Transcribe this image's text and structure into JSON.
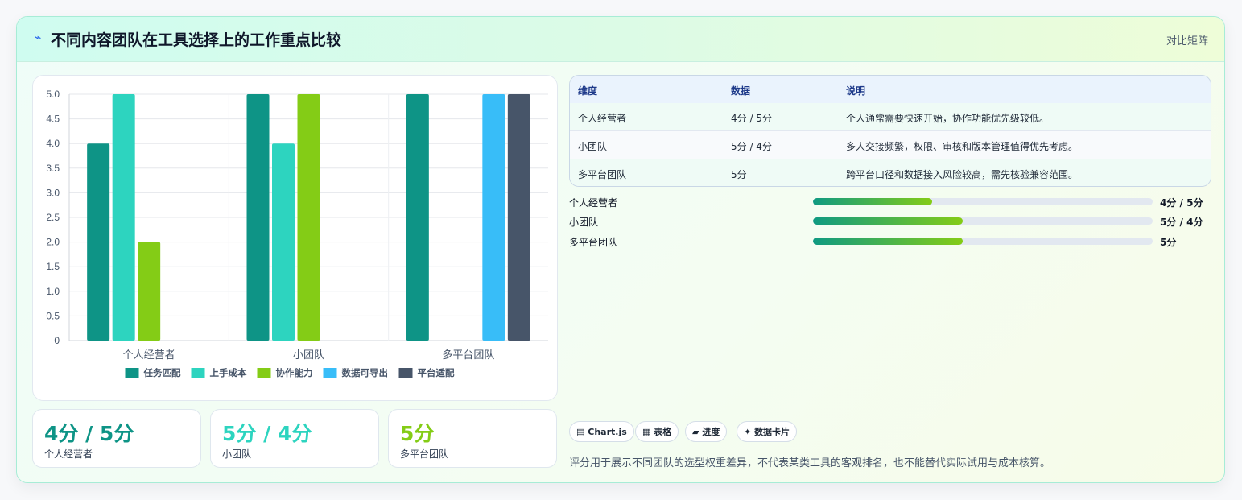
{
  "header": {
    "icon": "lightning-icon",
    "title": "不同内容团队在工具选择上的工作重点比较",
    "tag": "对比矩阵"
  },
  "colors": {
    "task_match": "#0e9486",
    "ease_cost": "#2dd4bf",
    "collaboration": "#84cc16",
    "data_export": "#38bdf8",
    "platform_fit": "#475569"
  },
  "chart_data": {
    "type": "bar",
    "categories": [
      "个人经营者",
      "小团队",
      "多平台团队"
    ],
    "series": [
      {
        "name": "任务匹配",
        "color": "#0e9486",
        "values": [
          4,
          5,
          5
        ]
      },
      {
        "name": "上手成本",
        "color": "#2dd4bf",
        "values": [
          5,
          4,
          null
        ]
      },
      {
        "name": "协作能力",
        "color": "#84cc16",
        "values": [
          2,
          5,
          null
        ]
      },
      {
        "name": "数据可导出",
        "color": "#38bdf8",
        "values": [
          null,
          null,
          5
        ]
      },
      {
        "name": "平台适配",
        "color": "#475569",
        "values": [
          null,
          null,
          5
        ]
      }
    ],
    "ylim": [
      0,
      5
    ],
    "yticks": [
      "0",
      "0.5",
      "1.0",
      "1.5",
      "2.0",
      "2.5",
      "3.0",
      "3.5",
      "4.0",
      "4.5",
      "5.0"
    ],
    "grid": true,
    "legend_position": "bottom"
  },
  "stats": [
    {
      "value": "4分 / 5分",
      "label": "个人经营者",
      "color": "#0e9486"
    },
    {
      "value": "5分 / 4分",
      "label": "小团队",
      "color": "#2dd4bf"
    },
    {
      "value": "5分",
      "label": "多平台团队",
      "color": "#84cc16"
    }
  ],
  "table": {
    "headers": [
      "维度",
      "数据",
      "说明"
    ],
    "rows": [
      [
        "个人经营者",
        "4分 / 5分",
        "个人通常需要快速开始，协作功能优先级较低。"
      ],
      [
        "小团队",
        "5分 / 4分",
        "多人交接频繁，权限、审核和版本管理值得优先考虑。"
      ],
      [
        "多平台团队",
        "5分",
        "跨平台口径和数据接入风险较高，需先核验兼容范围。"
      ]
    ]
  },
  "progress": [
    {
      "label": "个人经营者",
      "value": "4分 / 5分",
      "fraction": 0.35
    },
    {
      "label": "小团队",
      "value": "5分 / 4分",
      "fraction": 0.44
    },
    {
      "label": "多平台团队",
      "value": "5分",
      "fraction": 0.44
    }
  ],
  "chips": [
    {
      "icon": "chart-icon",
      "glyph": "▤",
      "label": "Chart.js"
    },
    {
      "icon": "table-icon",
      "glyph": "▦",
      "label": "表格"
    },
    {
      "icon": "progress-icon",
      "glyph": "▰",
      "label": "进度"
    },
    {
      "icon": "sparkle-icon",
      "glyph": "✦",
      "label": "数据卡片"
    }
  ],
  "note": "评分用于展示不同团队的选型权重差异，不代表某类工具的客观排名，也不能替代实际试用与成本核算。"
}
